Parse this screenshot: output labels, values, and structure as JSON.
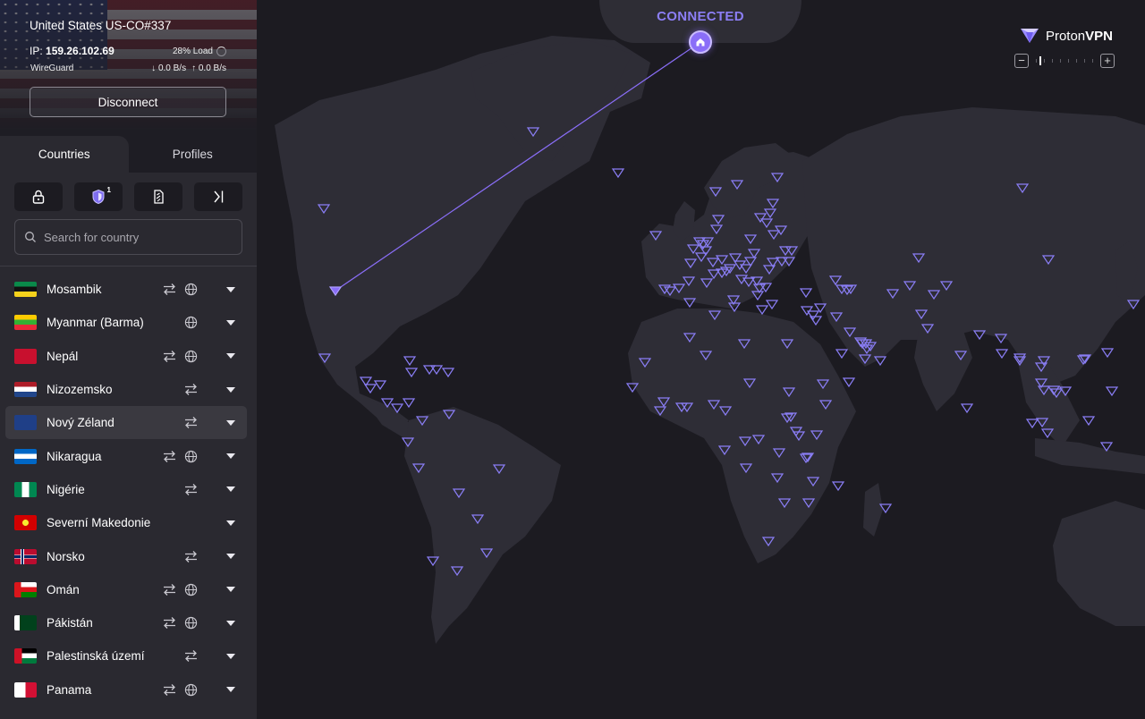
{
  "connection": {
    "server_name": "United States US-CO#337",
    "ip_label": "IP:",
    "ip": "159.26.102.69",
    "load": "28% Load",
    "protocol": "WireGuard",
    "download": "0.0 B/s",
    "upload": "0.0 B/s",
    "disconnect_label": "Disconnect",
    "status": "CONNECTED"
  },
  "tabs": [
    {
      "label": "Countries",
      "active": true
    },
    {
      "label": "Profiles",
      "active": false
    }
  ],
  "quick_filters": {
    "secure_core_badge": "1"
  },
  "search": {
    "placeholder": "Search for country"
  },
  "countries": [
    {
      "name": "Mosambik",
      "p2p": true,
      "tor": true,
      "flag": "mozambique-flag"
    },
    {
      "name": "Myanmar (Barma)",
      "p2p": false,
      "tor": true,
      "flag": "myanmar-flag"
    },
    {
      "name": "Nepál",
      "p2p": true,
      "tor": true,
      "flag": "nepal-flag"
    },
    {
      "name": "Nizozemsko",
      "p2p": true,
      "tor": false,
      "flag": "netherlands-flag"
    },
    {
      "name": "Nový Zéland",
      "p2p": true,
      "tor": false,
      "flag": "new-zealand-flag",
      "hovered": true
    },
    {
      "name": "Nikaragua",
      "p2p": true,
      "tor": true,
      "flag": "nicaragua-flag"
    },
    {
      "name": "Nigérie",
      "p2p": true,
      "tor": false,
      "flag": "nigeria-flag"
    },
    {
      "name": "Severní Makedonie",
      "p2p": false,
      "tor": false,
      "flag": "north-macedonia-flag"
    },
    {
      "name": "Norsko",
      "p2p": true,
      "tor": false,
      "flag": "norway-flag"
    },
    {
      "name": "Omán",
      "p2p": true,
      "tor": true,
      "flag": "oman-flag"
    },
    {
      "name": "Pákistán",
      "p2p": true,
      "tor": true,
      "flag": "pakistan-flag"
    },
    {
      "name": "Palestinská území",
      "p2p": true,
      "tor": false,
      "flag": "palestine-flag"
    },
    {
      "name": "Panama",
      "p2p": true,
      "tor": true,
      "flag": "panama-flag"
    }
  ],
  "brand": {
    "name_a": "Proton",
    "name_b": "VPN"
  },
  "colors": {
    "accent": "#8a6ef8",
    "status": "#8c7ef5",
    "sidebar": "#2a2930",
    "map_bg": "#1c1b21",
    "land": "#2e2d36"
  }
}
